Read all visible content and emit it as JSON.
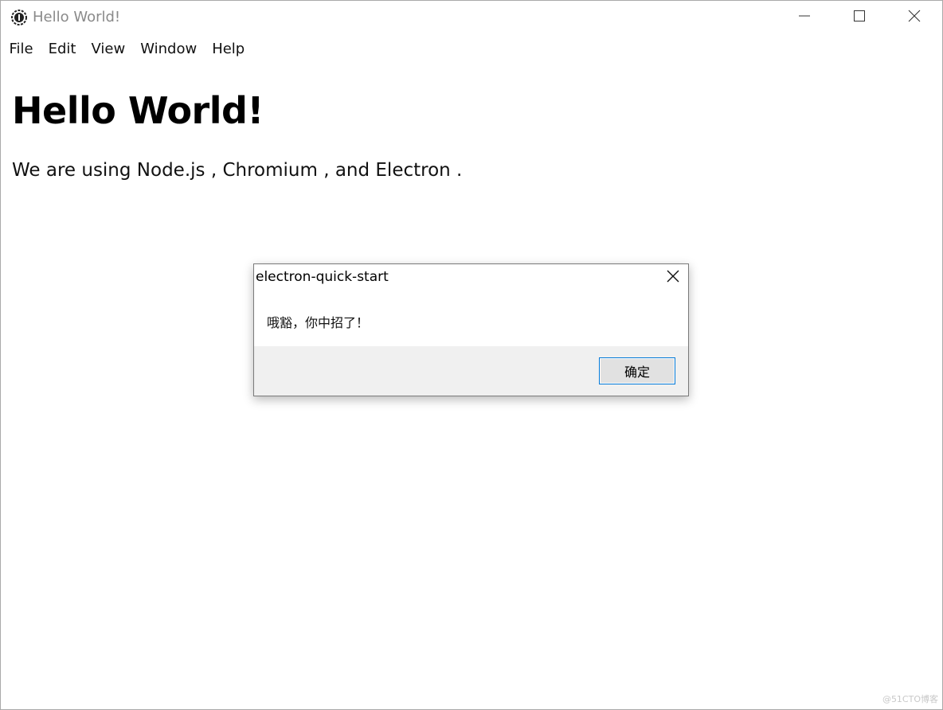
{
  "window": {
    "title": "Hello World!",
    "icon": "electron-atom-icon",
    "controls": {
      "minimize_icon": "minimize-icon",
      "maximize_icon": "maximize-icon",
      "close_icon": "close-icon"
    }
  },
  "menubar": {
    "items": [
      {
        "label": "File"
      },
      {
        "label": "Edit"
      },
      {
        "label": "View"
      },
      {
        "label": "Window"
      },
      {
        "label": "Help"
      }
    ]
  },
  "page": {
    "heading": "Hello World!",
    "paragraph": "We are using Node.js , Chromium , and Electron ."
  },
  "dialog": {
    "title": "electron-quick-start",
    "message": "哦豁，你中招了！",
    "ok_label": "确定",
    "close_icon": "close-icon",
    "accent_color": "#0078d7"
  },
  "watermark": "@51CTO博客",
  "colors": {
    "title_inactive": "#8a8a8a",
    "window_border": "#a9a9a9",
    "dialog_footer": "#f0f0f0",
    "button_focus": "#0078d7"
  }
}
